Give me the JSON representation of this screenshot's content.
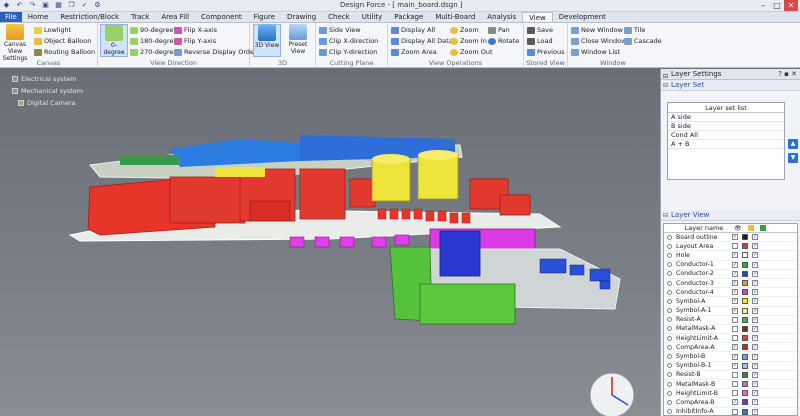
{
  "app": {
    "title": "Design Force - [ main_board.dsgn ]"
  },
  "menu": {
    "tabs": [
      "File",
      "Home",
      "Restriction/Block",
      "Track",
      "Area Fill",
      "Component",
      "Figure",
      "Drawing",
      "Check",
      "Utility",
      "Package",
      "Multi-Board",
      "Analysis",
      "View",
      "Development"
    ],
    "active": "View"
  },
  "ribbon": {
    "canvas": {
      "label": "Canvas",
      "settings": "Canvas View Settings",
      "lowlight": "Lowlight",
      "object_balloon": "Object Balloon",
      "routing_balloon": "Routing Balloon"
    },
    "view_direction": {
      "label": "View Direction",
      "zero_degree": "0-degree",
      "deg90": "90-degree",
      "deg180": "180-degree",
      "deg270": "270-degree",
      "flip_x": "Flip X-axis",
      "flip_y": "Flip Y-axis",
      "reverse": "Reverse Display Order"
    },
    "threed": {
      "label": "3D",
      "view_3d": "3D View",
      "preset": "Preset View"
    },
    "cutting": {
      "label": "Cutting Plane",
      "side_view": "Side View",
      "clip_x": "Clip X-direction",
      "clip_y": "Clip Y-direction"
    },
    "view_ops": {
      "label": "View Operations",
      "display_all": "Display All",
      "display_all_data": "Display All Data",
      "zoom_area": "Zoom Area",
      "zoom": "Zoom",
      "zoom_in": "Zoom In",
      "zoom_out": "Zoom Out",
      "pan": "Pan",
      "rotate": "Rotate"
    },
    "stored": {
      "label": "Stored View",
      "save": "Save",
      "load": "Load",
      "previous": "Previous"
    },
    "window": {
      "label": "Window",
      "new_window": "New Window",
      "close_window": "Close Window",
      "window_list": "Window List",
      "tile": "Tile",
      "cascade": "Cascade"
    }
  },
  "tree": {
    "items": [
      "Electrical system",
      "Mechanical system",
      "Digital Camera"
    ]
  },
  "panel": {
    "title": "Layer Settings",
    "layer_set_title": "Layer Set",
    "set_list_header": "Layer set list",
    "sets": [
      "A side",
      "B side",
      "Cond All",
      "A + B"
    ],
    "layer_view_title": "Layer View",
    "layer_name_header": "Layer name",
    "layers": [
      {
        "name": "Board outline",
        "color": "#1a1a1a",
        "vis": true,
        "sel": true
      },
      {
        "name": "Layout Area",
        "color": "#d23b3b",
        "vis": false,
        "sel": true
      },
      {
        "name": "Hole",
        "color": "#ffffff",
        "vis": true,
        "sel": true
      },
      {
        "name": "Conductor-1",
        "color": "#2fae3a",
        "vis": true,
        "sel": true
      },
      {
        "name": "Conductor-2",
        "color": "#2244cc",
        "vis": true,
        "sel": true
      },
      {
        "name": "Conductor-3",
        "color": "#e89a2a",
        "vis": true,
        "sel": true
      },
      {
        "name": "Conductor-4",
        "color": "#d63ad6",
        "vis": true,
        "sel": true
      },
      {
        "name": "Symbol-A",
        "color": "#f2e93a",
        "vis": true,
        "sel": true
      },
      {
        "name": "Symbol-A-1",
        "color": "#f6f07a",
        "vis": true,
        "sel": true
      },
      {
        "name": "Resist-A",
        "color": "#3ab46a",
        "vis": false,
        "sel": true
      },
      {
        "name": "MetalMask-A",
        "color": "#7a2a2a",
        "vis": false,
        "sel": true
      },
      {
        "name": "HeightLimit-A",
        "color": "#e24040",
        "vis": false,
        "sel": true
      },
      {
        "name": "CompArea-A",
        "color": "#d22020",
        "vis": true,
        "sel": true
      },
      {
        "name": "Symbol-B",
        "color": "#6aa0e0",
        "vis": true,
        "sel": true
      },
      {
        "name": "Symbol-B-1",
        "color": "#9ac0f0",
        "vis": true,
        "sel": true
      },
      {
        "name": "Resist-B",
        "color": "#3a8a3a",
        "vis": false,
        "sel": true
      },
      {
        "name": "MetalMask-B",
        "color": "#b07ab0",
        "vis": false,
        "sel": true
      },
      {
        "name": "HeightLimit-B",
        "color": "#e06ad0",
        "vis": false,
        "sel": true
      },
      {
        "name": "CompArea-B",
        "color": "#6a3ad6",
        "vis": true,
        "sel": true
      },
      {
        "name": "InhibitInfo-A",
        "color": "#2a7ad6",
        "vis": false,
        "sel": true
      }
    ]
  }
}
